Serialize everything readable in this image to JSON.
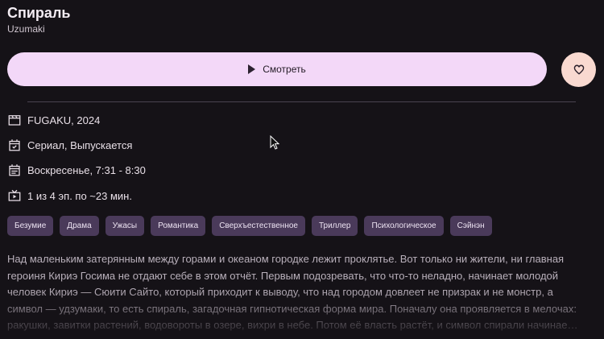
{
  "header": {
    "title": "Спираль",
    "subtitle": "Uzumaki"
  },
  "actions": {
    "watch_label": "Смотреть",
    "watch_icon": "play-icon",
    "favorite_icon": "heart-icon"
  },
  "info": [
    {
      "icon": "clapperboard-icon",
      "text": "FUGAKU, 2024"
    },
    {
      "icon": "calendar-check-icon",
      "text": "Сериал, Выпускается"
    },
    {
      "icon": "calendar-schedule-icon",
      "text": "Воскресенье, 7:31 - 8:30"
    },
    {
      "icon": "tv-play-icon",
      "text": "1 из 4 эп. по ~23 мин."
    }
  ],
  "tags": [
    "Безумие",
    "Драма",
    "Ужасы",
    "Романтика",
    "Сверхъестественное",
    "Триллер",
    "Психологическое",
    "Сэйнэн"
  ],
  "description": [
    "Над маленьким затерянным между горами и океаном городке лежит проклятье. Вот только ни жители, ни главная",
    "героиня Кириэ Госима не отдают себе в этом отчёт. Первым подозревать, что что-то неладно, начинает молодой",
    "человек Кириэ — Сюити Сайто, который приходит к выводу, что над городом довлеет не призрак и не монстр, а",
    "символ — удзумаки, то есть спираль, загадочная гипнотическая форма мира. Поначалу она проявляется в мелочах:",
    "ракушки, завитки растений, водовороты в озере, вихри в небе. Потом её власть растёт, и символ спирали начинае…"
  ],
  "colors": {
    "background": "#151217",
    "watch_button": "#f3d8f8",
    "favorite_button": "#f9d9d0",
    "tag_background": "#4a3a5a"
  }
}
